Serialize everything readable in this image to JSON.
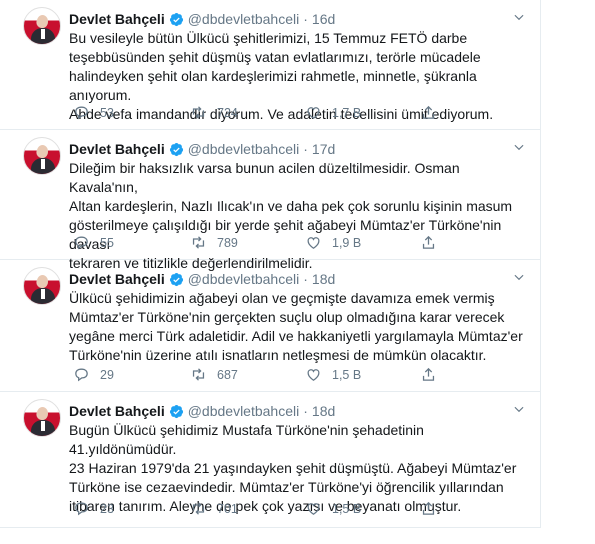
{
  "tweets": [
    {
      "name": "Devlet Bahçeli",
      "handle": "@dbdevletbahceli",
      "separator": "·",
      "time": "16d",
      "text": "Bu vesileyle bütün Ülkücü şehitlerimizi, 15 Temmuz FETÖ darbe\nteşebbüsünden şehit düşmüş vatan evlatlarımızı, terörle mücadele\nhalindeyken şehit olan kardeşlerimizi rahmetle, minnetle, şükranla anıyorum.\nAhde vefa imandandır diyorum. Ve adaletin tecellisini ümit ediyorum.",
      "replies": "53",
      "retweets": "724",
      "likes": "1,7 B"
    },
    {
      "name": "Devlet Bahçeli",
      "handle": "@dbdevletbahceli",
      "separator": "·",
      "time": "17d",
      "text": "Dileğim bir haksızlık varsa bunun acilen düzeltilmesidir. Osman Kavala'nın,\nAltan kardeşlerin, Nazlı Ilıcak'ın ve daha pek çok sorunlu kişinin masum\ngösterilmeye çalışıldığı bir yerde şehit ağabeyi Mümtaz'er Türköne'nin davası\ntekraren ve titizlikle değerlendirilmelidir.",
      "replies": "55",
      "retweets": "789",
      "likes": "1,9 B"
    },
    {
      "name": "Devlet Bahçeli",
      "handle": "@dbdevletbahceli",
      "separator": "·",
      "time": "18d",
      "text": "Ülkücü şehidimizin ağabeyi olan ve geçmişte davamıza emek vermiş\nMümtaz'er Türköne'nin gerçekten suçlu olup olmadığına karar verecek\nyegâne merci Türk adaletidir. Adil ve hakkaniyetli yargılamayla Mümtaz'er\nTürköne'nin üzerine atılı isnatların netleşmesi de mümkün olacaktır.",
      "replies": "29",
      "retweets": "687",
      "likes": "1,5 B"
    },
    {
      "name": "Devlet Bahçeli",
      "handle": "@dbdevletbahceli",
      "separator": "·",
      "time": "18d",
      "text": "Bugün Ülkücü şehidimiz Mustafa Türköne'nin şehadetinin 41.yıldönümüdür.\n23 Haziran 1979'da 21 yaşındayken şehit düşmüştü. Ağabeyi Mümtaz'er\nTürköne ise cezaevindedir. Mümtaz'er Türköne'yi öğrencilik yıllarından\nitibaren tanırım. Aleyhe de pek çok yazısı ve beyanatı olmuştur.",
      "replies": "23",
      "retweets": "701",
      "likes": "1,5 B"
    }
  ],
  "icons": {
    "verified": "verified-badge-icon",
    "caret": "chevron-down-icon",
    "reply": "reply-icon",
    "retweet": "retweet-icon",
    "like": "heart-icon",
    "share": "share-icon"
  },
  "colors": {
    "accent": "#1da1f2",
    "muted": "#657786",
    "border": "#e6ecf0"
  }
}
